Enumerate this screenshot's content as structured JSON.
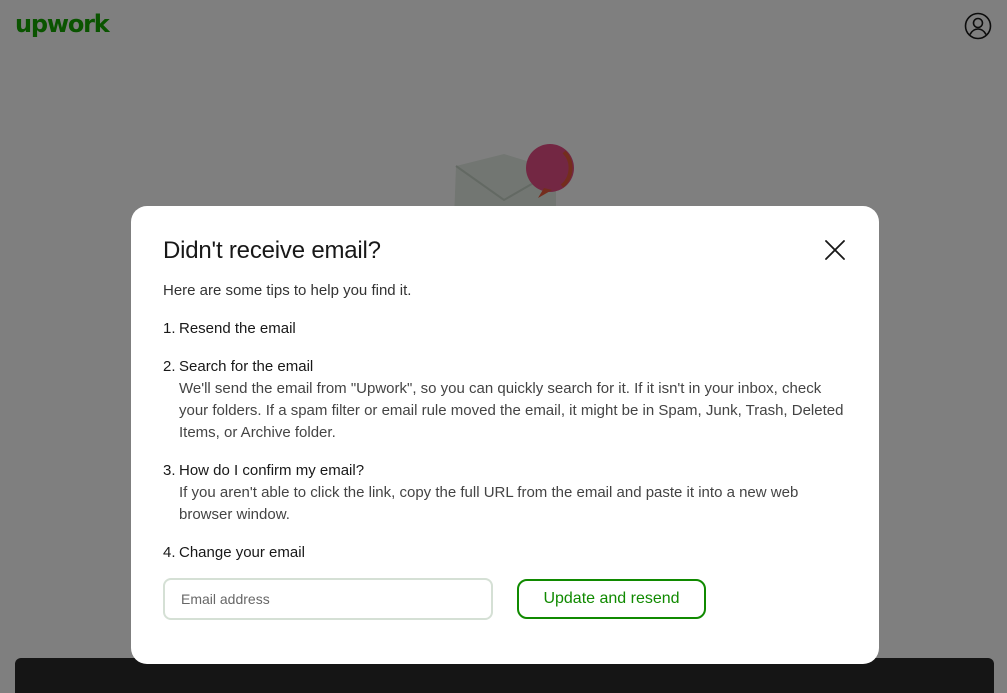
{
  "header": {
    "logo_text": "upwork",
    "profile_icon": "user-circle-icon"
  },
  "illustration": {
    "icon": "envelope-with-notification-icon"
  },
  "modal": {
    "title": "Didn't receive email?",
    "subtitle": "Here are some tips to help you find it.",
    "close_icon": "close-icon",
    "steps": [
      {
        "num": "1.",
        "title": "Resend the email",
        "desc": ""
      },
      {
        "num": "2.",
        "title": "Search for the email",
        "desc": "We'll send the email from \"Upwork\", so you can quickly search for it. If it isn't in your inbox, check your folders. If a spam filter or email rule moved the email, it might be in Spam, Junk, Trash, Deleted Items, or Archive folder."
      },
      {
        "num": "3.",
        "title": "How do I confirm my email?",
        "desc": "If you aren't able to click the link, copy the full URL from the email and paste it into a new web browser window."
      },
      {
        "num": "4.",
        "title": "Change your email",
        "desc": ""
      }
    ],
    "email_input": {
      "value": "",
      "placeholder": "Email address"
    },
    "resend_button_label": "Update and resend"
  },
  "colors": {
    "brand_green": "#14a800",
    "button_green": "#108a00",
    "overlay": "rgba(0,0,0,0.5)"
  }
}
